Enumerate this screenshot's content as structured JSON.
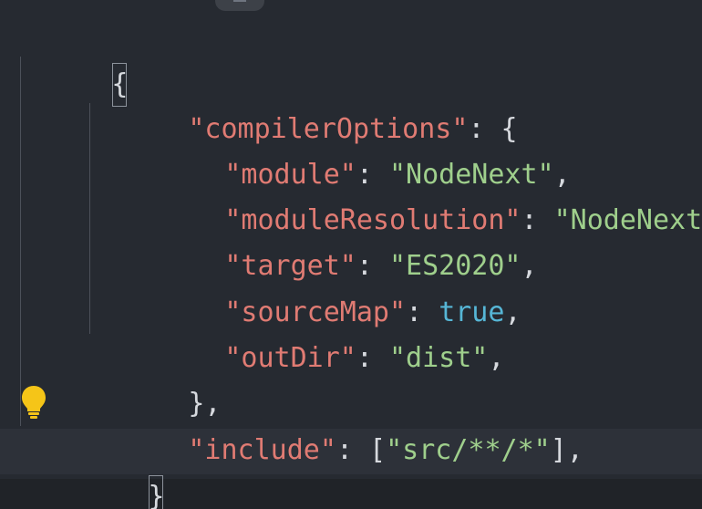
{
  "editor": {
    "lines": [
      {
        "open": "{"
      },
      {
        "key": "\"compilerOptions\"",
        "sep": ": ",
        "value": "{"
      },
      {
        "key": "\"module\"",
        "sep": ": ",
        "value": "\"NodeNext\"",
        "end": ","
      },
      {
        "key": "\"moduleResolution\"",
        "sep": ": ",
        "value": "\"NodeNext\"",
        "end": ","
      },
      {
        "key": "\"target\"",
        "sep": ": ",
        "value": "\"ES2020\"",
        "end": ","
      },
      {
        "key": "\"sourceMap\"",
        "sep": ": ",
        "value": "true",
        "end": ","
      },
      {
        "key": "\"outDir\"",
        "sep": ": ",
        "value": "\"dist\"",
        "end": ","
      },
      {
        "close": "},"
      },
      {
        "key": "\"include\"",
        "sep": ": [",
        "value": "\"src/**/*\"",
        "end": "],"
      },
      {
        "close": "}"
      }
    ]
  },
  "colors": {
    "background": "#262a31",
    "key": "#e07b73",
    "string": "#9fcf8c",
    "boolean": "#56b6d6",
    "lightbulb": "#f5c518"
  },
  "icons": {
    "lightbulb": "lightbulb-icon"
  }
}
